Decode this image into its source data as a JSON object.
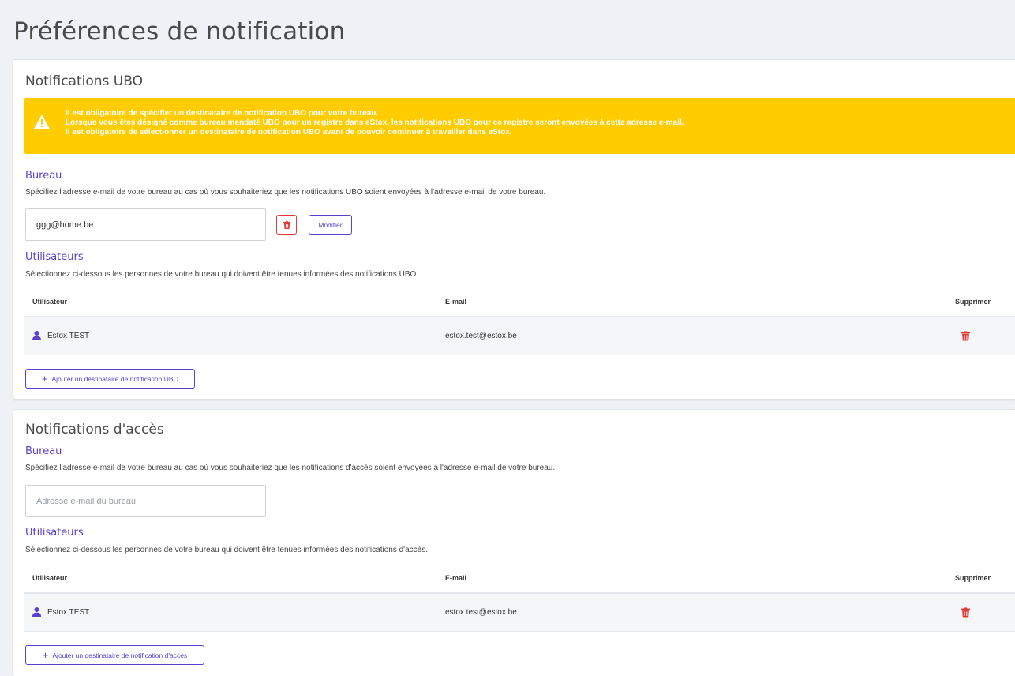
{
  "page": {
    "title": "Préférences de notification"
  },
  "ubo": {
    "title": "Notifications UBO",
    "alert": {
      "lines": [
        "Il est obligatoire de spécifier un destinataire de notification UBO pour votre bureau.",
        "Lorsque vous êtes désigné comme bureau mandaté UBO pour un registre dans eStox, les notifications UBO pour ce registre seront envoyées à cette adresse e-mail.",
        "Il est obligatoire de sélectionner un destinataire de notification UBO avant de pouvoir continuer à travailler dans eStox."
      ]
    },
    "bureau": {
      "title": "Bureau",
      "description": "Spécifiez l'adresse e-mail de votre bureau au cas où vous souhaiteriez que les notifications UBO soient envoyées à l'adresse e-mail de votre bureau.",
      "email_value": "ggg@home.be",
      "modify_label": "Modifier"
    },
    "users": {
      "title": "Utilisateurs",
      "description": "Sélectionnez ci-dessous les personnes de votre bureau qui doivent être tenues informées des notifications UBO.",
      "columns": {
        "user": "Utilisateur",
        "email": "E-mail",
        "delete": "Supprimer"
      },
      "rows": [
        {
          "name": "Estox TEST",
          "email": "estox.test@estox.be"
        }
      ],
      "add_label": "Ajouter un destinataire de notification UBO"
    }
  },
  "access": {
    "title": "Notifications d'accès",
    "bureau": {
      "title": "Bureau",
      "description": "Spécifiez l'adresse e-mail de votre bureau au cas où vous souhaiteriez que les notifications d'accès soient envoyées à l'adresse e-mail de votre bureau.",
      "email_placeholder": "Adresse e-mail du bureau"
    },
    "users": {
      "title": "Utilisateurs",
      "description": "Sélectionnez ci-dessous les personnes de votre bureau qui doivent être tenues informées des notifications d'accès.",
      "columns": {
        "user": "Utilisateur",
        "email": "E-mail",
        "delete": "Supprimer"
      },
      "rows": [
        {
          "name": "Estox TEST",
          "email": "estox.test@estox.be"
        }
      ],
      "add_label": "Ajouter un destinataire de notification d'accès"
    }
  },
  "colors": {
    "accent": "#5a3fd0",
    "warning": "#ffcc00",
    "danger": "#e53935",
    "background": "#eef1f5"
  },
  "icons": {
    "warning": "warning-triangle-icon",
    "delete": "trash-icon",
    "user": "user-icon",
    "add": "plus-icon"
  }
}
